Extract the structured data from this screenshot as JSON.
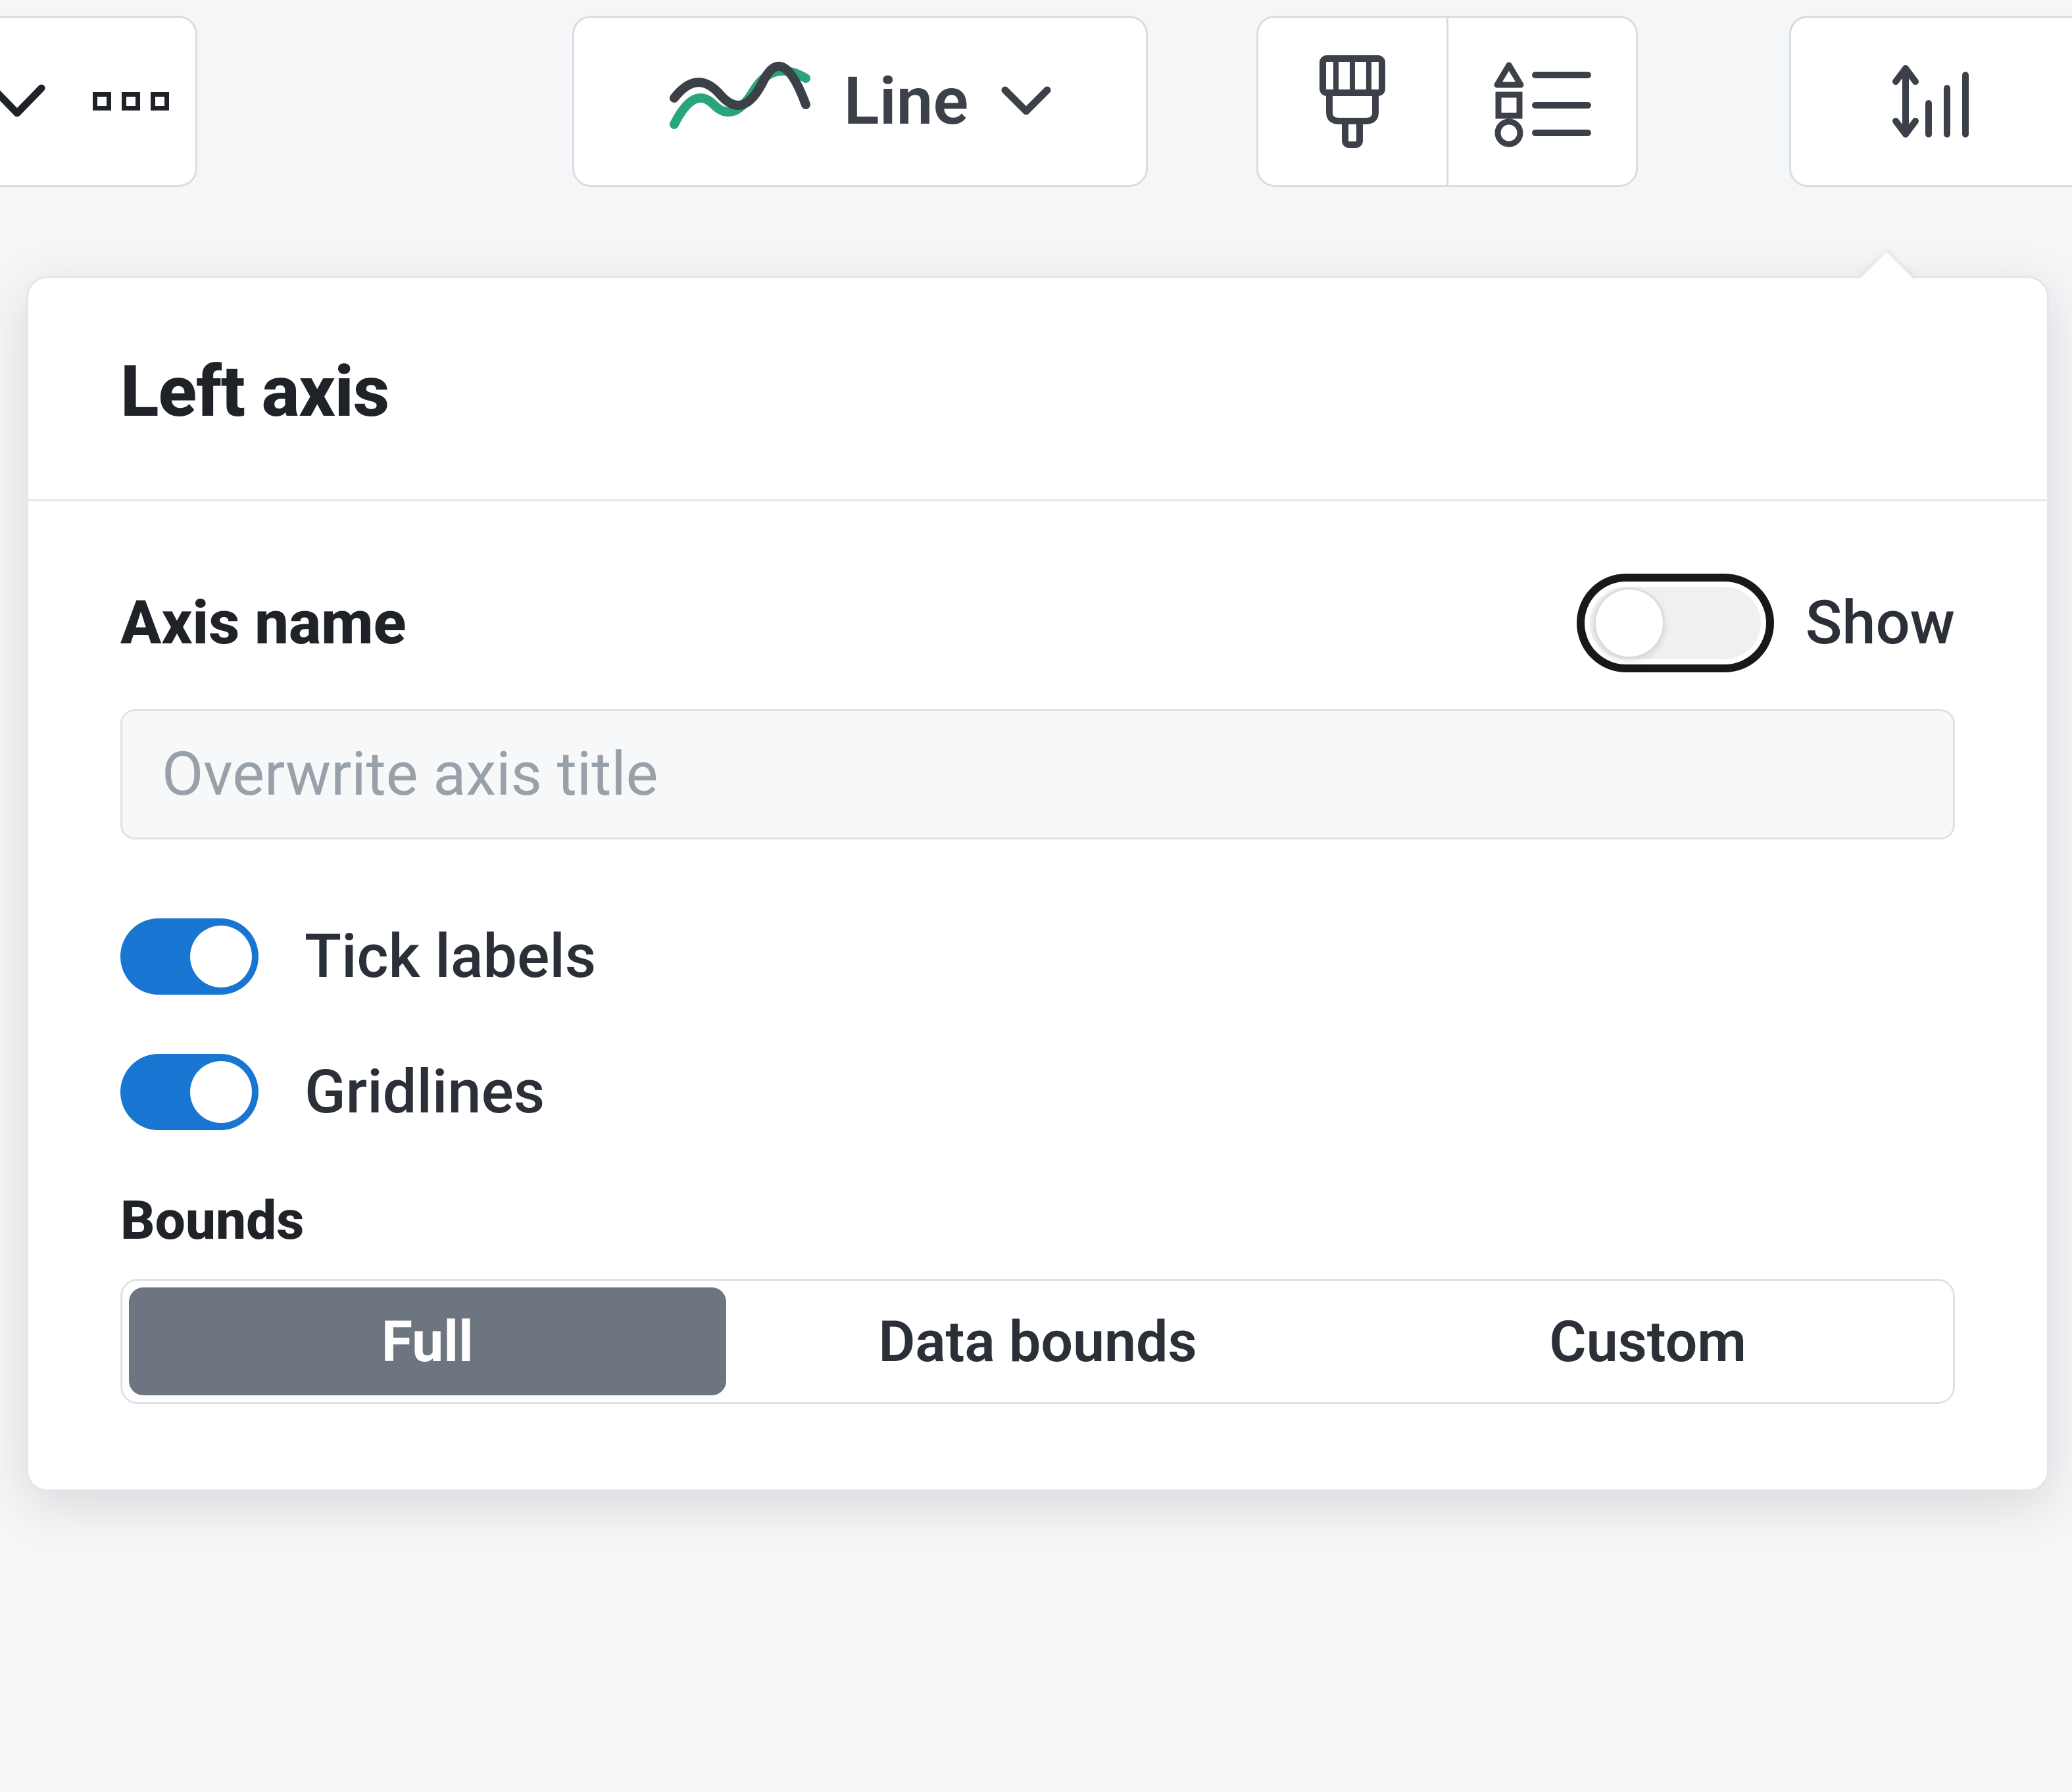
{
  "toolbar": {
    "chart_type_label": "Line"
  },
  "popover": {
    "title": "Left axis",
    "axis_name": {
      "label": "Axis name",
      "toggle_label": "Show",
      "show": false,
      "input_placeholder": "Overwrite axis title",
      "input_value": ""
    },
    "tick_labels": {
      "label": "Tick labels",
      "value": true
    },
    "gridlines": {
      "label": "Gridlines",
      "value": true
    },
    "bounds": {
      "label": "Bounds",
      "options": [
        "Full",
        "Data bounds",
        "Custom"
      ],
      "selected": "Full"
    }
  }
}
